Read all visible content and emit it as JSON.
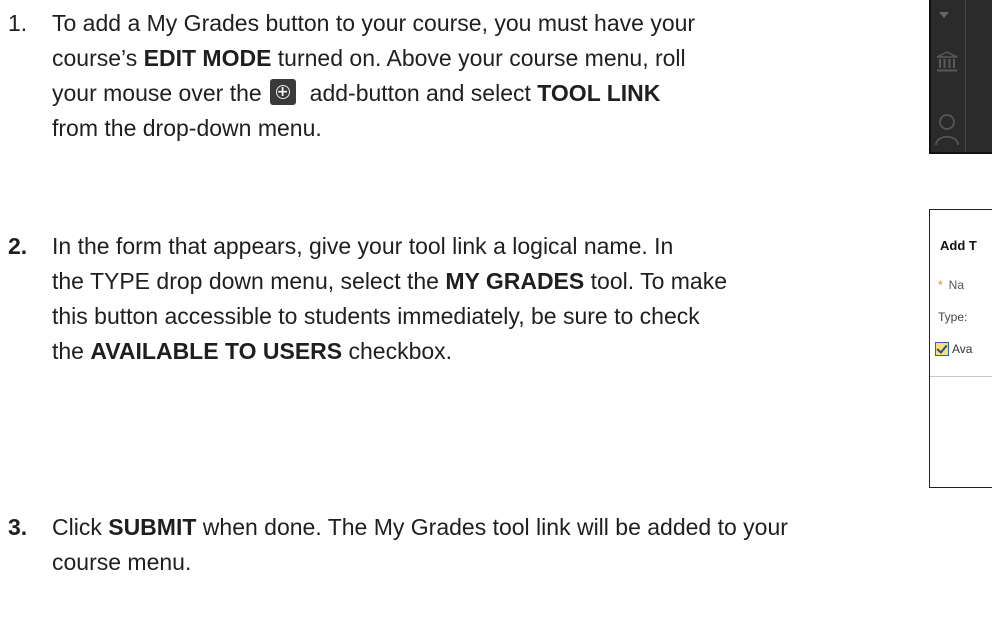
{
  "steps": [
    {
      "number": "1.",
      "line1": "To add a My Grades button to your course, you must have your",
      "line2_pre": "course’s ",
      "line2_bold": "EDIT MODE",
      "line2_post": " turned on.  Above your course menu, roll",
      "line3_pre": "your mouse over the",
      "line3_post": "add-button and select ",
      "line3_bold": "TOOL LINK",
      "line4": "from the drop-down menu."
    },
    {
      "number": "2.",
      "line1": "In the form that appears, give your tool link a logical name. In",
      "line2_pre": "the TYPE drop down menu, select the ",
      "line2_bold": "MY GRADES",
      "line2_post": " tool. To make",
      "line3": "this button accessible to students immediately, be sure to check",
      "line4_pre": "the ",
      "line4_bold": "AVAILABLE TO USERS",
      "line4_post": " checkbox."
    },
    {
      "number": "3.",
      "line1_pre": "Click ",
      "line1_bold": "SUBMIT",
      "line1_post": " when done. The My Grades tool link will be added to your",
      "line2": "course menu."
    }
  ],
  "icons": {
    "add_button": "add-circle-icon",
    "menu_caret": "caret-down-icon",
    "institution": "institution-icon",
    "user": "user-icon",
    "required": "required-star-icon",
    "checkbox": "checked-checkbox-icon"
  },
  "form_crop": {
    "title": "Add T",
    "name_star": "*",
    "name_label": "Na",
    "type_label": "Type:",
    "available_label": "Ava"
  },
  "colors": {
    "text": "#1f1f1f",
    "menu_bg": "#2b2b2b",
    "required_star": "#d98a1c",
    "checkbox_border": "#2a64b5",
    "checkbox_fill": "#f6e07a"
  }
}
